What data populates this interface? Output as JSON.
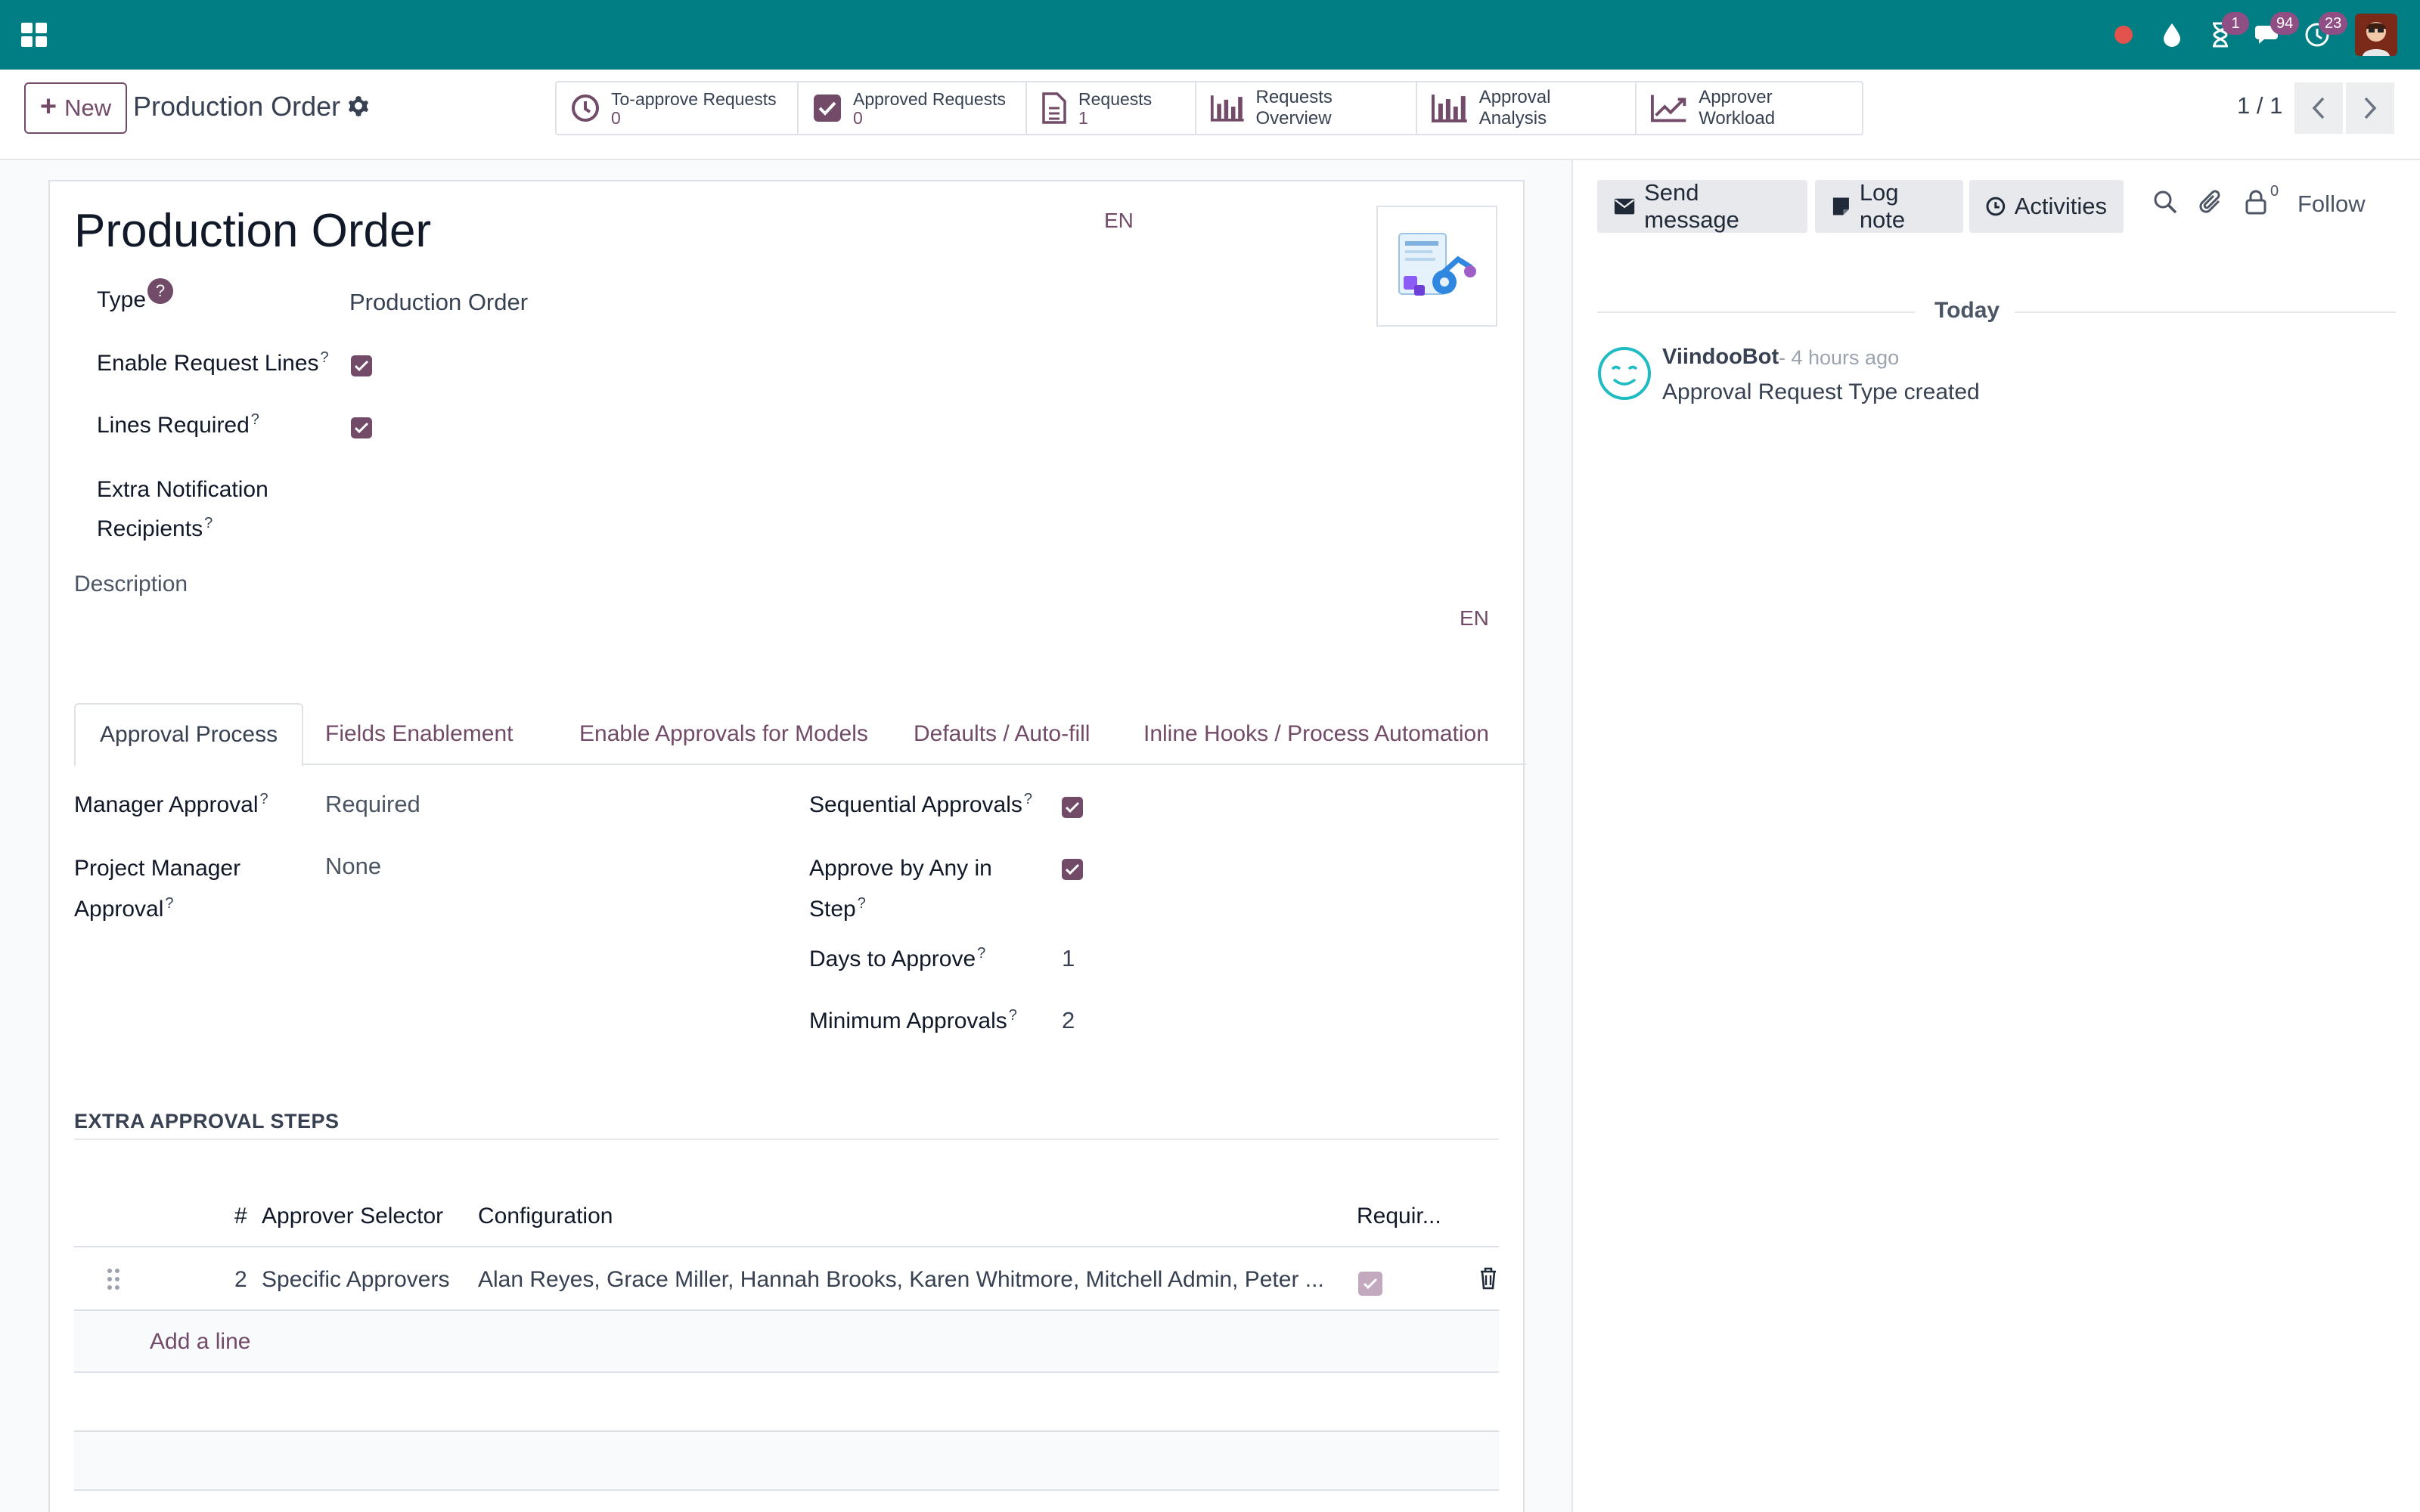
{
  "topbar": {
    "badges": {
      "activities": "1",
      "messages": "94",
      "clock": "23"
    }
  },
  "control": {
    "new_label": "New",
    "record_title": "Production Order",
    "smart_buttons": [
      {
        "label": "To-approve Requests",
        "value": "0"
      },
      {
        "label": "Approved Requests",
        "value": "0"
      },
      {
        "label": "Requests",
        "value": "1"
      },
      {
        "label": "Requests Overview"
      },
      {
        "label": "Approval Analysis"
      },
      {
        "label": "Approver Workload"
      }
    ],
    "pager": "1 / 1"
  },
  "form": {
    "title": "Production Order",
    "lang_code": "EN",
    "fields": {
      "type": {
        "label": "Type",
        "help": "?",
        "value": "Production Order"
      },
      "enable_request_lines": {
        "label": "Enable Request Lines",
        "help": "?"
      },
      "lines_required": {
        "label": "Lines Required",
        "help": "?"
      },
      "extra_recipients": {
        "label_line1": "Extra Notification",
        "label_line2": "Recipients",
        "help": "?"
      }
    },
    "description_label": "Description",
    "description_lang": "EN",
    "tabs": [
      "Approval Process",
      "Fields Enablement",
      "Enable Approvals for Models",
      "Defaults / Auto-fill",
      "Inline Hooks / Process Automation"
    ],
    "approval": {
      "manager_approval": {
        "label": "Manager Approval",
        "help": "?",
        "value": "Required"
      },
      "project_manager_approval": {
        "label_line1": "Project Manager",
        "label_line2": "Approval",
        "help": "?",
        "value": "None"
      },
      "sequential": {
        "label": "Sequential Approvals",
        "help": "?"
      },
      "approve_by_any": {
        "label_line1": "Approve by Any in",
        "label_line2": "Step",
        "help": "?"
      },
      "days_to_approve": {
        "label": "Days to Approve",
        "help": "?",
        "value": "1"
      },
      "minimum_approvals": {
        "label": "Minimum Approvals",
        "help": "?",
        "value": "2"
      }
    },
    "extra_steps": {
      "title": "EXTRA APPROVAL STEPS",
      "columns": [
        "#",
        "Approver Selector",
        "Configuration",
        "Requir..."
      ],
      "rows": [
        {
          "seq": "2",
          "selector": "Specific Approvers",
          "configuration": "Alan Reyes, Grace Miller, Hannah Brooks, Karen Whitmore, Mitchell Admin, Peter ...",
          "required": true
        }
      ],
      "add_line": "Add a line"
    }
  },
  "chatter": {
    "send_message": "Send message",
    "log_note": "Log note",
    "activities": "Activities",
    "follower_count": "0",
    "follow": "Follow",
    "date_separator": "Today",
    "messages": [
      {
        "author": "ViindooBot",
        "time": "- 4 hours ago",
        "body": "Approval Request Type created"
      }
    ]
  }
}
